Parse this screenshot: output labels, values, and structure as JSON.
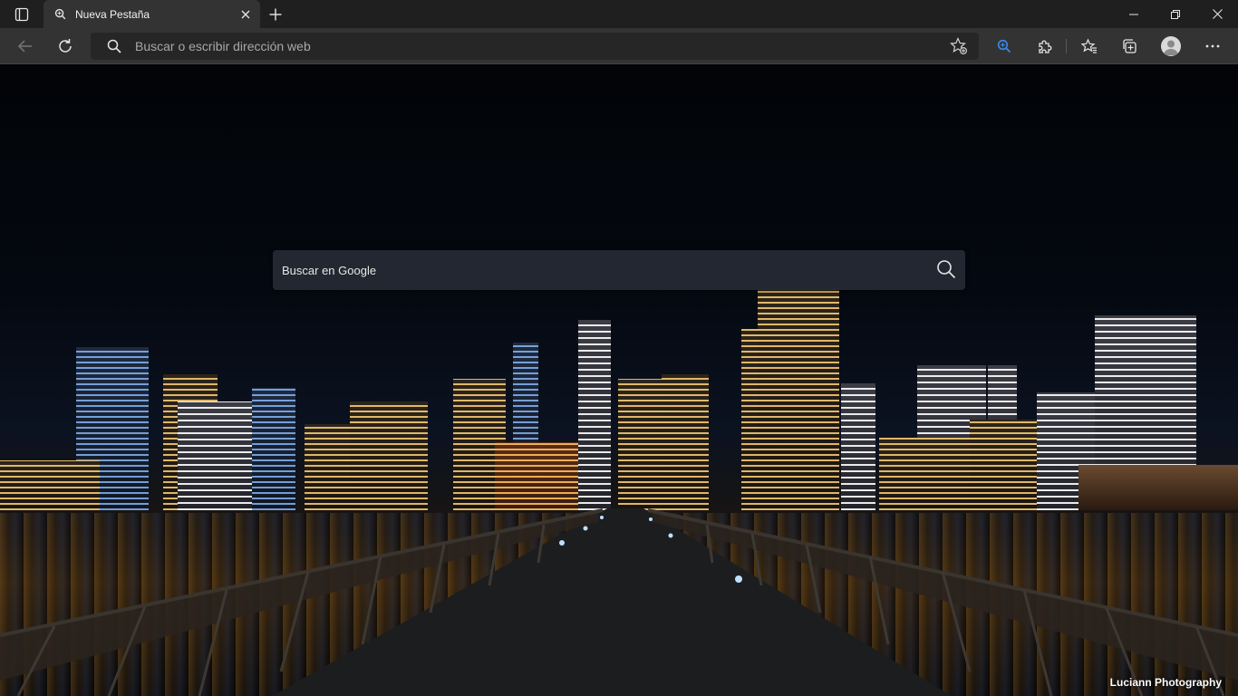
{
  "tab": {
    "title": "Nueva Pestaña",
    "icon": "search-icon"
  },
  "toolbar": {
    "address_placeholder": "Buscar o escribir dirección web",
    "icons": [
      "back-icon",
      "refresh-icon",
      "search-icon",
      "favorite-add-icon",
      "zoom-icon",
      "extensions-icon",
      "favorites-icon",
      "collections-icon",
      "profile-icon",
      "more-icon"
    ]
  },
  "window_controls": [
    "minimize-icon",
    "restore-icon",
    "close-icon"
  ],
  "newtab": {
    "search_placeholder": "Buscar en Google",
    "photo_credit": "Luciann Photography"
  },
  "colors": {
    "titlebar": "#1f1f1f",
    "toolbar": "#333333",
    "address": "#262626",
    "accent": "#2f7fd8"
  }
}
